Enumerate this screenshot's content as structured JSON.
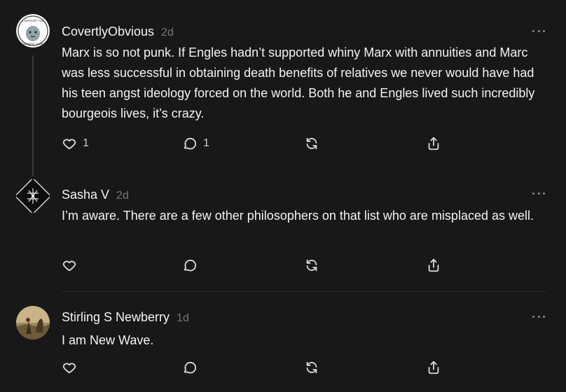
{
  "comments": [
    {
      "author": "CovertlyObvious",
      "time": "2d",
      "body": "Marx is so not punk. If Engles hadn’t supported whiny Marx with annuities and Marc was less successful in obtaining death benefits of relatives we never would have had his teen angst ideology forced on the world. Both he and Engles lived such incredibly bourgeois lives, it’s crazy.",
      "like_count": "1",
      "reply_count": "1",
      "avatar_text_top": "I SUPPORT THE",
      "avatar_text_bottom": "CURRENT THING"
    },
    {
      "author": "Sasha V",
      "time": "2d",
      "body": "I’m aware. There are a few other philosophers on that list who are misplaced as well.",
      "like_count": "",
      "reply_count": ""
    },
    {
      "author": "Stirling S Newberry",
      "time": "1d",
      "body": "I am New Wave.",
      "like_count": "",
      "reply_count": ""
    }
  ],
  "colors": {
    "background": "#181818",
    "text": "#f3f3f3",
    "muted": "#777777",
    "thread_line": "#3a3a3a"
  },
  "icons": [
    "heart-icon",
    "comment-icon",
    "restack-icon",
    "share-icon",
    "more-icon"
  ]
}
